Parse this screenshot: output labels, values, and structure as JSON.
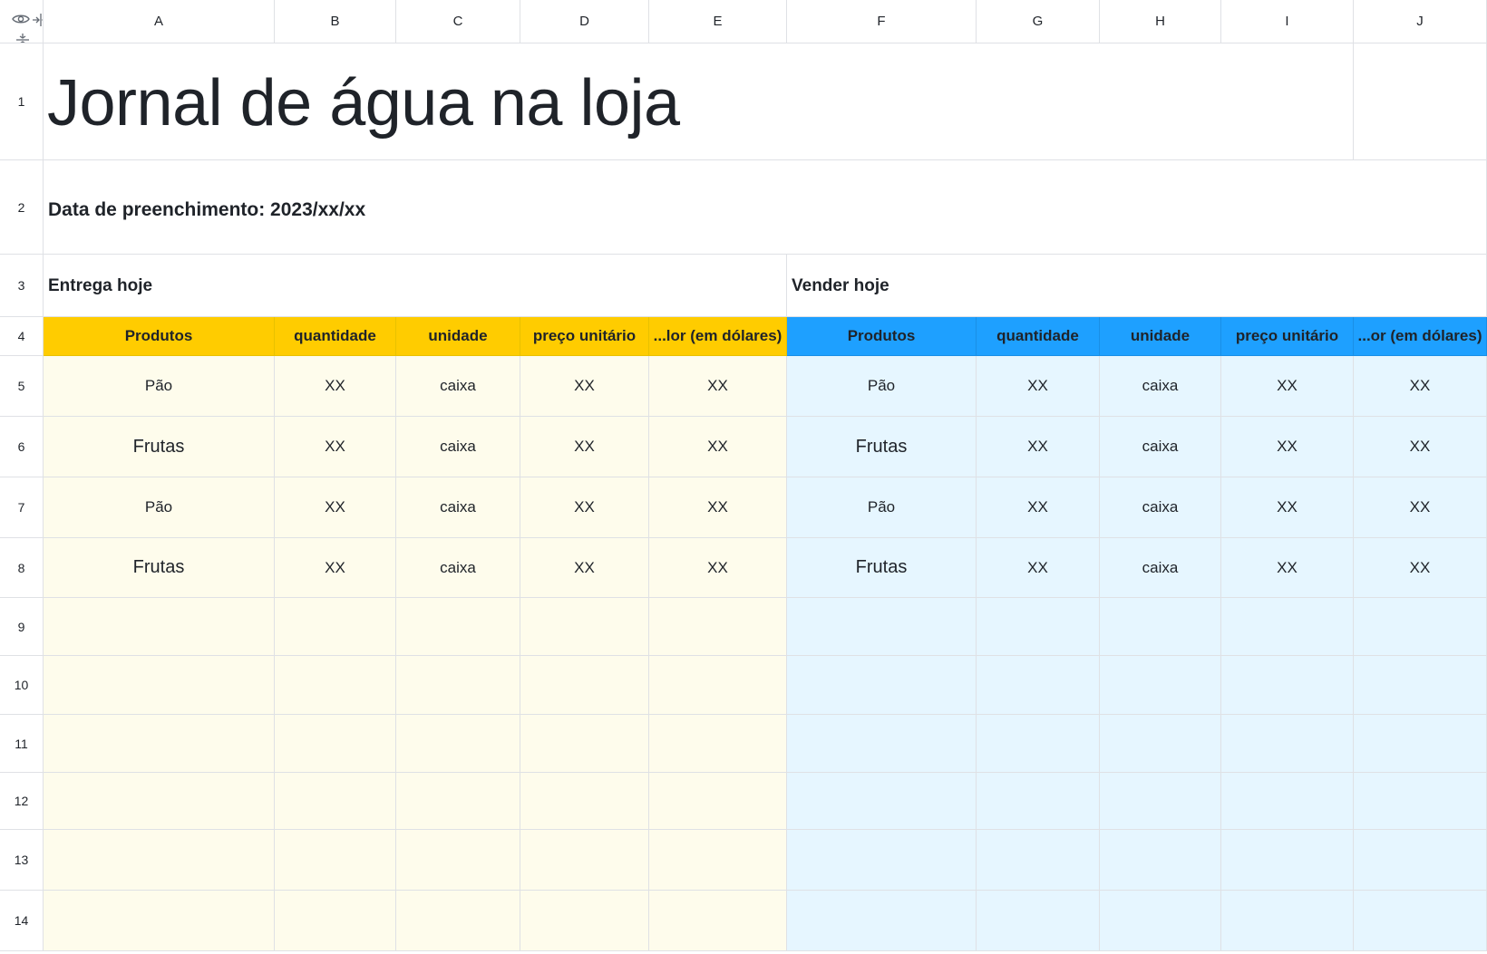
{
  "columns": [
    "A",
    "B",
    "C",
    "D",
    "E",
    "F",
    "G",
    "H",
    "I",
    "J"
  ],
  "rows": [
    "1",
    "2",
    "3",
    "4",
    "5",
    "6",
    "7",
    "8",
    "9",
    "10",
    "11",
    "12",
    "13",
    "14"
  ],
  "title": "Jornal de água na loja",
  "fill_date": "Data de preenchimento: 2023/xx/xx",
  "sections": {
    "delivery": "Entrega hoje",
    "sales": "Vender hoje"
  },
  "headers": {
    "left": [
      "Produtos",
      "quantidade",
      "unidade",
      "preço unitário",
      "...lor (em dólares)"
    ],
    "right": [
      "Produtos",
      "quantidade",
      "unidade",
      "preço unitário",
      "...or (em dólares)"
    ]
  },
  "data_rows": [
    [
      "Pão",
      "XX",
      "caixa",
      "XX",
      "XX",
      "Pão",
      "XX",
      "caixa",
      "XX",
      "XX"
    ],
    [
      "Frutas",
      "XX",
      "caixa",
      "XX",
      "XX",
      "Frutas",
      "XX",
      "caixa",
      "XX",
      "XX"
    ],
    [
      "Pão",
      "XX",
      "caixa",
      "XX",
      "XX",
      "Pão",
      "XX",
      "caixa",
      "XX",
      "XX"
    ],
    [
      "Frutas",
      "XX",
      "caixa",
      "XX",
      "XX",
      "Frutas",
      "XX",
      "caixa",
      "XX",
      "XX"
    ]
  ],
  "empty_row_count": 6,
  "colors": {
    "delivery_header": "#ffcc00",
    "delivery_fill": "#fefcec",
    "sales_header": "#1ea0ff",
    "sales_fill": "#e6f6ff",
    "grid_line": "#dfe1e5"
  },
  "icons": {
    "visibility": "eye-icon",
    "column_freeze": "freeze-columns-icon",
    "row_freeze": "freeze-rows-icon"
  }
}
